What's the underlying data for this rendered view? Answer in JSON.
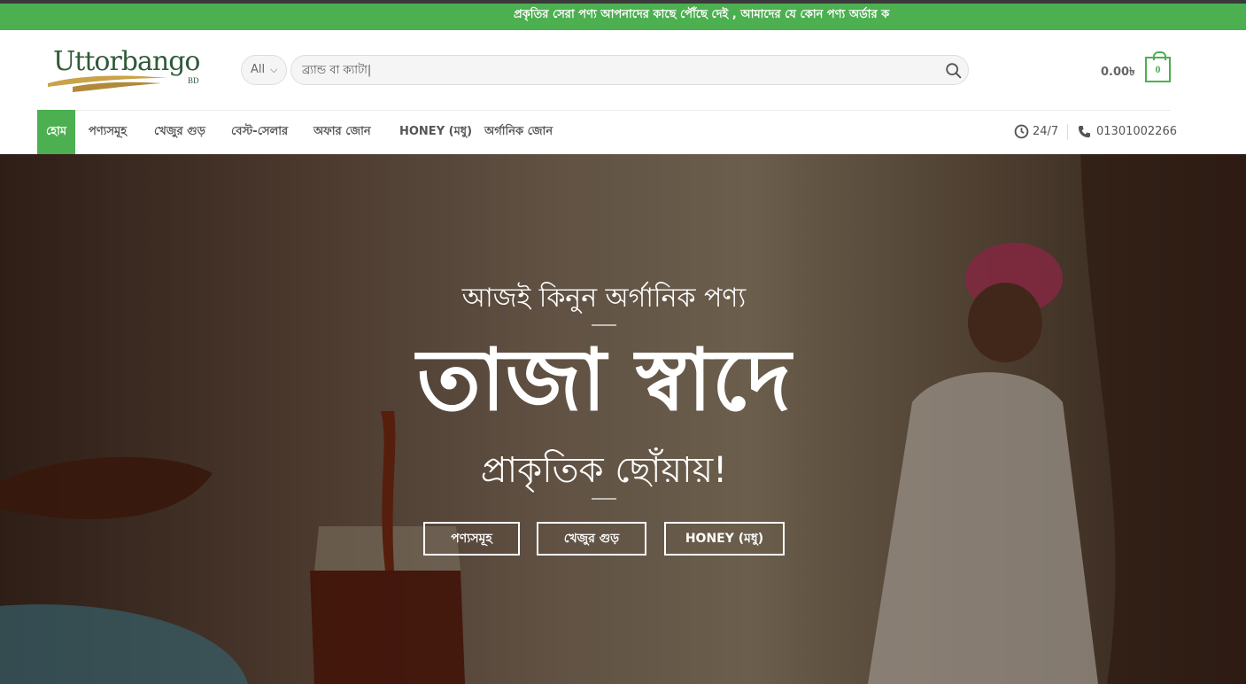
{
  "announcement": "প্রকৃতির সেরা পণ্য আপনাদের কাছে পৌঁছে দেই , আমাদের যে কোন পণ্য অর্ডার ক",
  "logo": {
    "text": "Uttorbango",
    "suffix": "BD"
  },
  "search": {
    "category": "All",
    "placeholder": "ব্র্যান্ড বা ক্যাটা|"
  },
  "cart": {
    "total": "0.00৳",
    "count": "0"
  },
  "nav": {
    "items": [
      "হোম",
      "পণ্যসমূহ",
      "খেজুর গুড়",
      "বেস্ট-সেলার",
      "অফার জোন",
      "HONEY (মধু)",
      "অর্গানিক জোন"
    ],
    "hours": "24/7",
    "phone": "01301002266"
  },
  "hero": {
    "subtitle": "আজই কিনুন অর্গানিক পণ্য",
    "title": "তাজা স্বাদে",
    "tagline": "প্রাকৃতিক ছোঁয়ায়!",
    "buttons": [
      "পণ্যসমূহ",
      "খেজুর গুড়",
      "HONEY (মধু)"
    ]
  },
  "colors": {
    "accent": "#4caf50",
    "text": "#555555"
  }
}
